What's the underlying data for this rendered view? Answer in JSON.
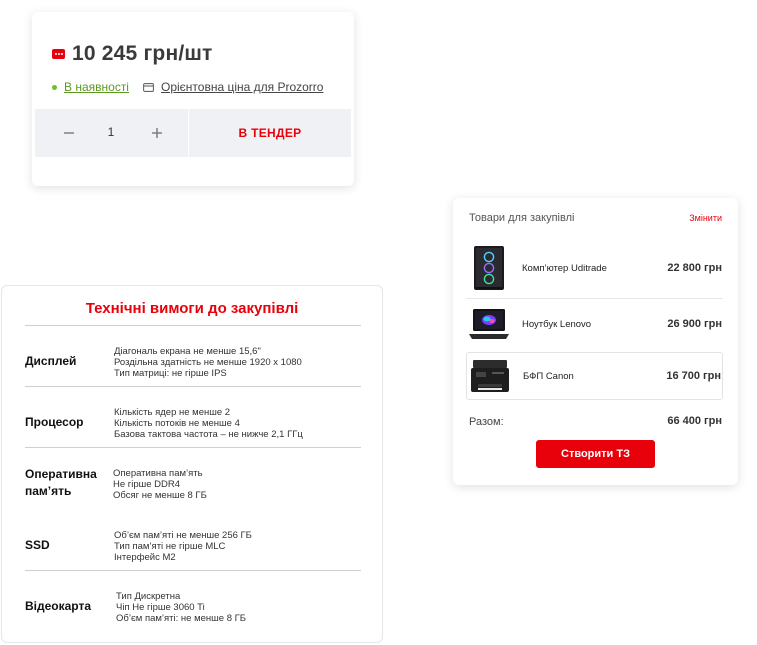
{
  "colors": {
    "accent": "#e8000b",
    "in_stock": "#6cbf2e"
  },
  "price_card": {
    "badge_icon": "more-dots-icon",
    "price": "10 245 грн/шт",
    "stock_status": "В наявності",
    "prozorro_icon": "document-icon",
    "prozorro_link": "Орієнтовна ціна для Prozorro",
    "quantity": "1",
    "minus_icon": "minus-icon",
    "plus_icon": "plus-icon",
    "tender_button": "В ТЕНДЕР"
  },
  "requirements": {
    "title": "Технічні вимоги до закупівлі",
    "rows": [
      {
        "label": "Дисплей",
        "lines": [
          "Діагональ екрана не менше 15,6\"",
          "Роздільна здатність не менше 1920 x 1080",
          "Тип матриці: не гірше IPS"
        ]
      },
      {
        "label": "Процесор",
        "lines": [
          "Кількість ядер не менше 2",
          "Кількість потоків не менше 4",
          "Базова тактова частота – не нижче 2,1 ГГц"
        ]
      },
      {
        "label": "Оперативна пам’ять",
        "lines": [
          "Оперативна пам’ять",
          "Не гірше DDR4",
          "Обсяг не менше 8 ГБ"
        ]
      },
      {
        "label": "SSD",
        "lines": [
          "Об’єм пам’яті не менше 256 ГБ",
          "Тип пам’яті не гірше MLC",
          "Інтерфейс M2"
        ]
      },
      {
        "label": "Відеокарта",
        "lines": [
          "Тип Дискретна",
          "Чіп Не гірше 3060 Ti",
          "Об’єм пам’яті: не менше 8 ГБ"
        ]
      }
    ]
  },
  "cart": {
    "title": "Товари для закупівлі",
    "change_link": "Змінити",
    "items": [
      {
        "icon": "desktop-pc-icon",
        "name": "Комп’ютер Uditrade",
        "price": "22 800 грн"
      },
      {
        "icon": "laptop-icon",
        "name": "Ноутбук Lenovo",
        "price": "26 900 грн"
      },
      {
        "icon": "printer-icon",
        "name": "БФП Canon",
        "price": "16 700 грн"
      }
    ],
    "total_label": "Разом:",
    "total_value": "66 400 грн",
    "create_button": "Створити ТЗ"
  }
}
